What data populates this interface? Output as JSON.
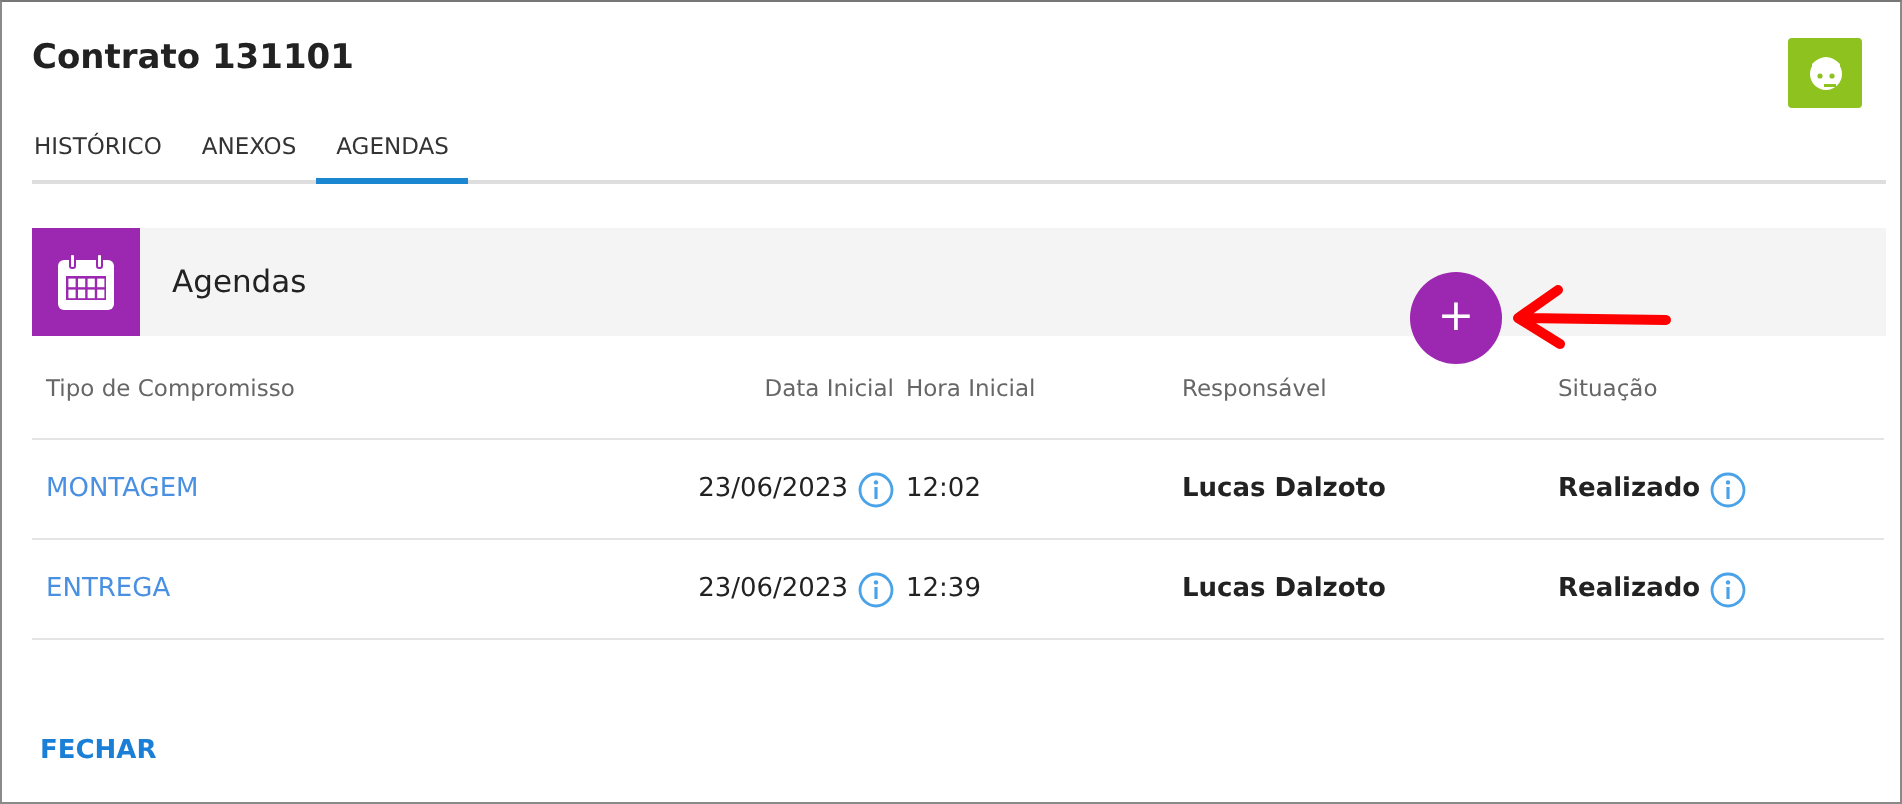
{
  "title": "Contrato 131101",
  "tabs": [
    {
      "label": "HISTÓRICO",
      "selected": false
    },
    {
      "label": "ANEXOS",
      "selected": false
    },
    {
      "label": "AGENDAS",
      "selected": true
    }
  ],
  "section": {
    "title": "Agendas"
  },
  "add_button": {
    "label": "+"
  },
  "table": {
    "columns": [
      "Tipo de Compromisso",
      "Data Inicial",
      "Hora Inicial",
      "Responsável",
      "Situação"
    ],
    "rows": [
      {
        "tipo": "MONTAGEM",
        "data": "23/06/2023",
        "hora": "12:02",
        "responsavel": "Lucas Dalzoto",
        "situacao": "Realizado"
      },
      {
        "tipo": "ENTREGA",
        "data": "23/06/2023",
        "hora": "12:39",
        "responsavel": "Lucas Dalzoto",
        "situacao": "Realizado"
      }
    ]
  },
  "close_button": {
    "label": "FECHAR"
  }
}
